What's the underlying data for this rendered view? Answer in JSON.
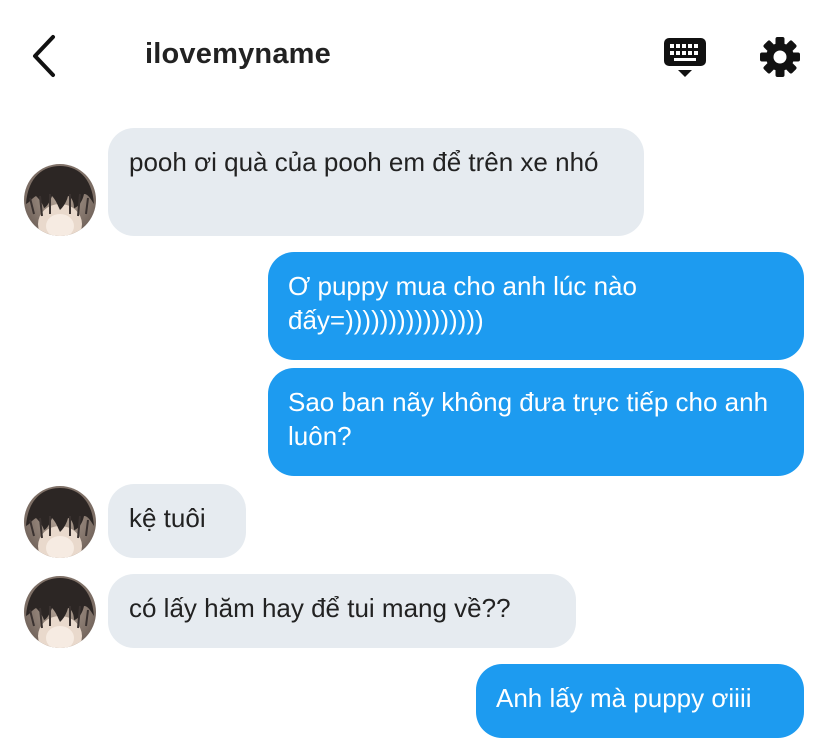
{
  "header": {
    "title": "ilovemyname"
  },
  "icons": {
    "back": "chevron-left-icon",
    "keyboard": "keyboard-icon",
    "settings": "gear-icon"
  },
  "colors": {
    "incoming_bubble": "#e6ebf0",
    "outgoing_bubble": "#1d9bf0",
    "text_dark": "#222222"
  },
  "messages": [
    {
      "direction": "incoming",
      "text": "pooh ơi quà của pooh em để trên xe nhó"
    },
    {
      "direction": "outgoing",
      "text": "Ơ puppy mua cho anh lúc nào đấy=))))))))))))))))"
    },
    {
      "direction": "outgoing",
      "text": "Sao ban nãy không đưa trực tiếp cho anh luôn?"
    },
    {
      "direction": "incoming",
      "text": "kệ tuôi"
    },
    {
      "direction": "incoming",
      "text": "có lấy hăm hay để tui mang về??"
    },
    {
      "direction": "outgoing",
      "text": "Anh lấy mà puppy ơiiii"
    }
  ]
}
